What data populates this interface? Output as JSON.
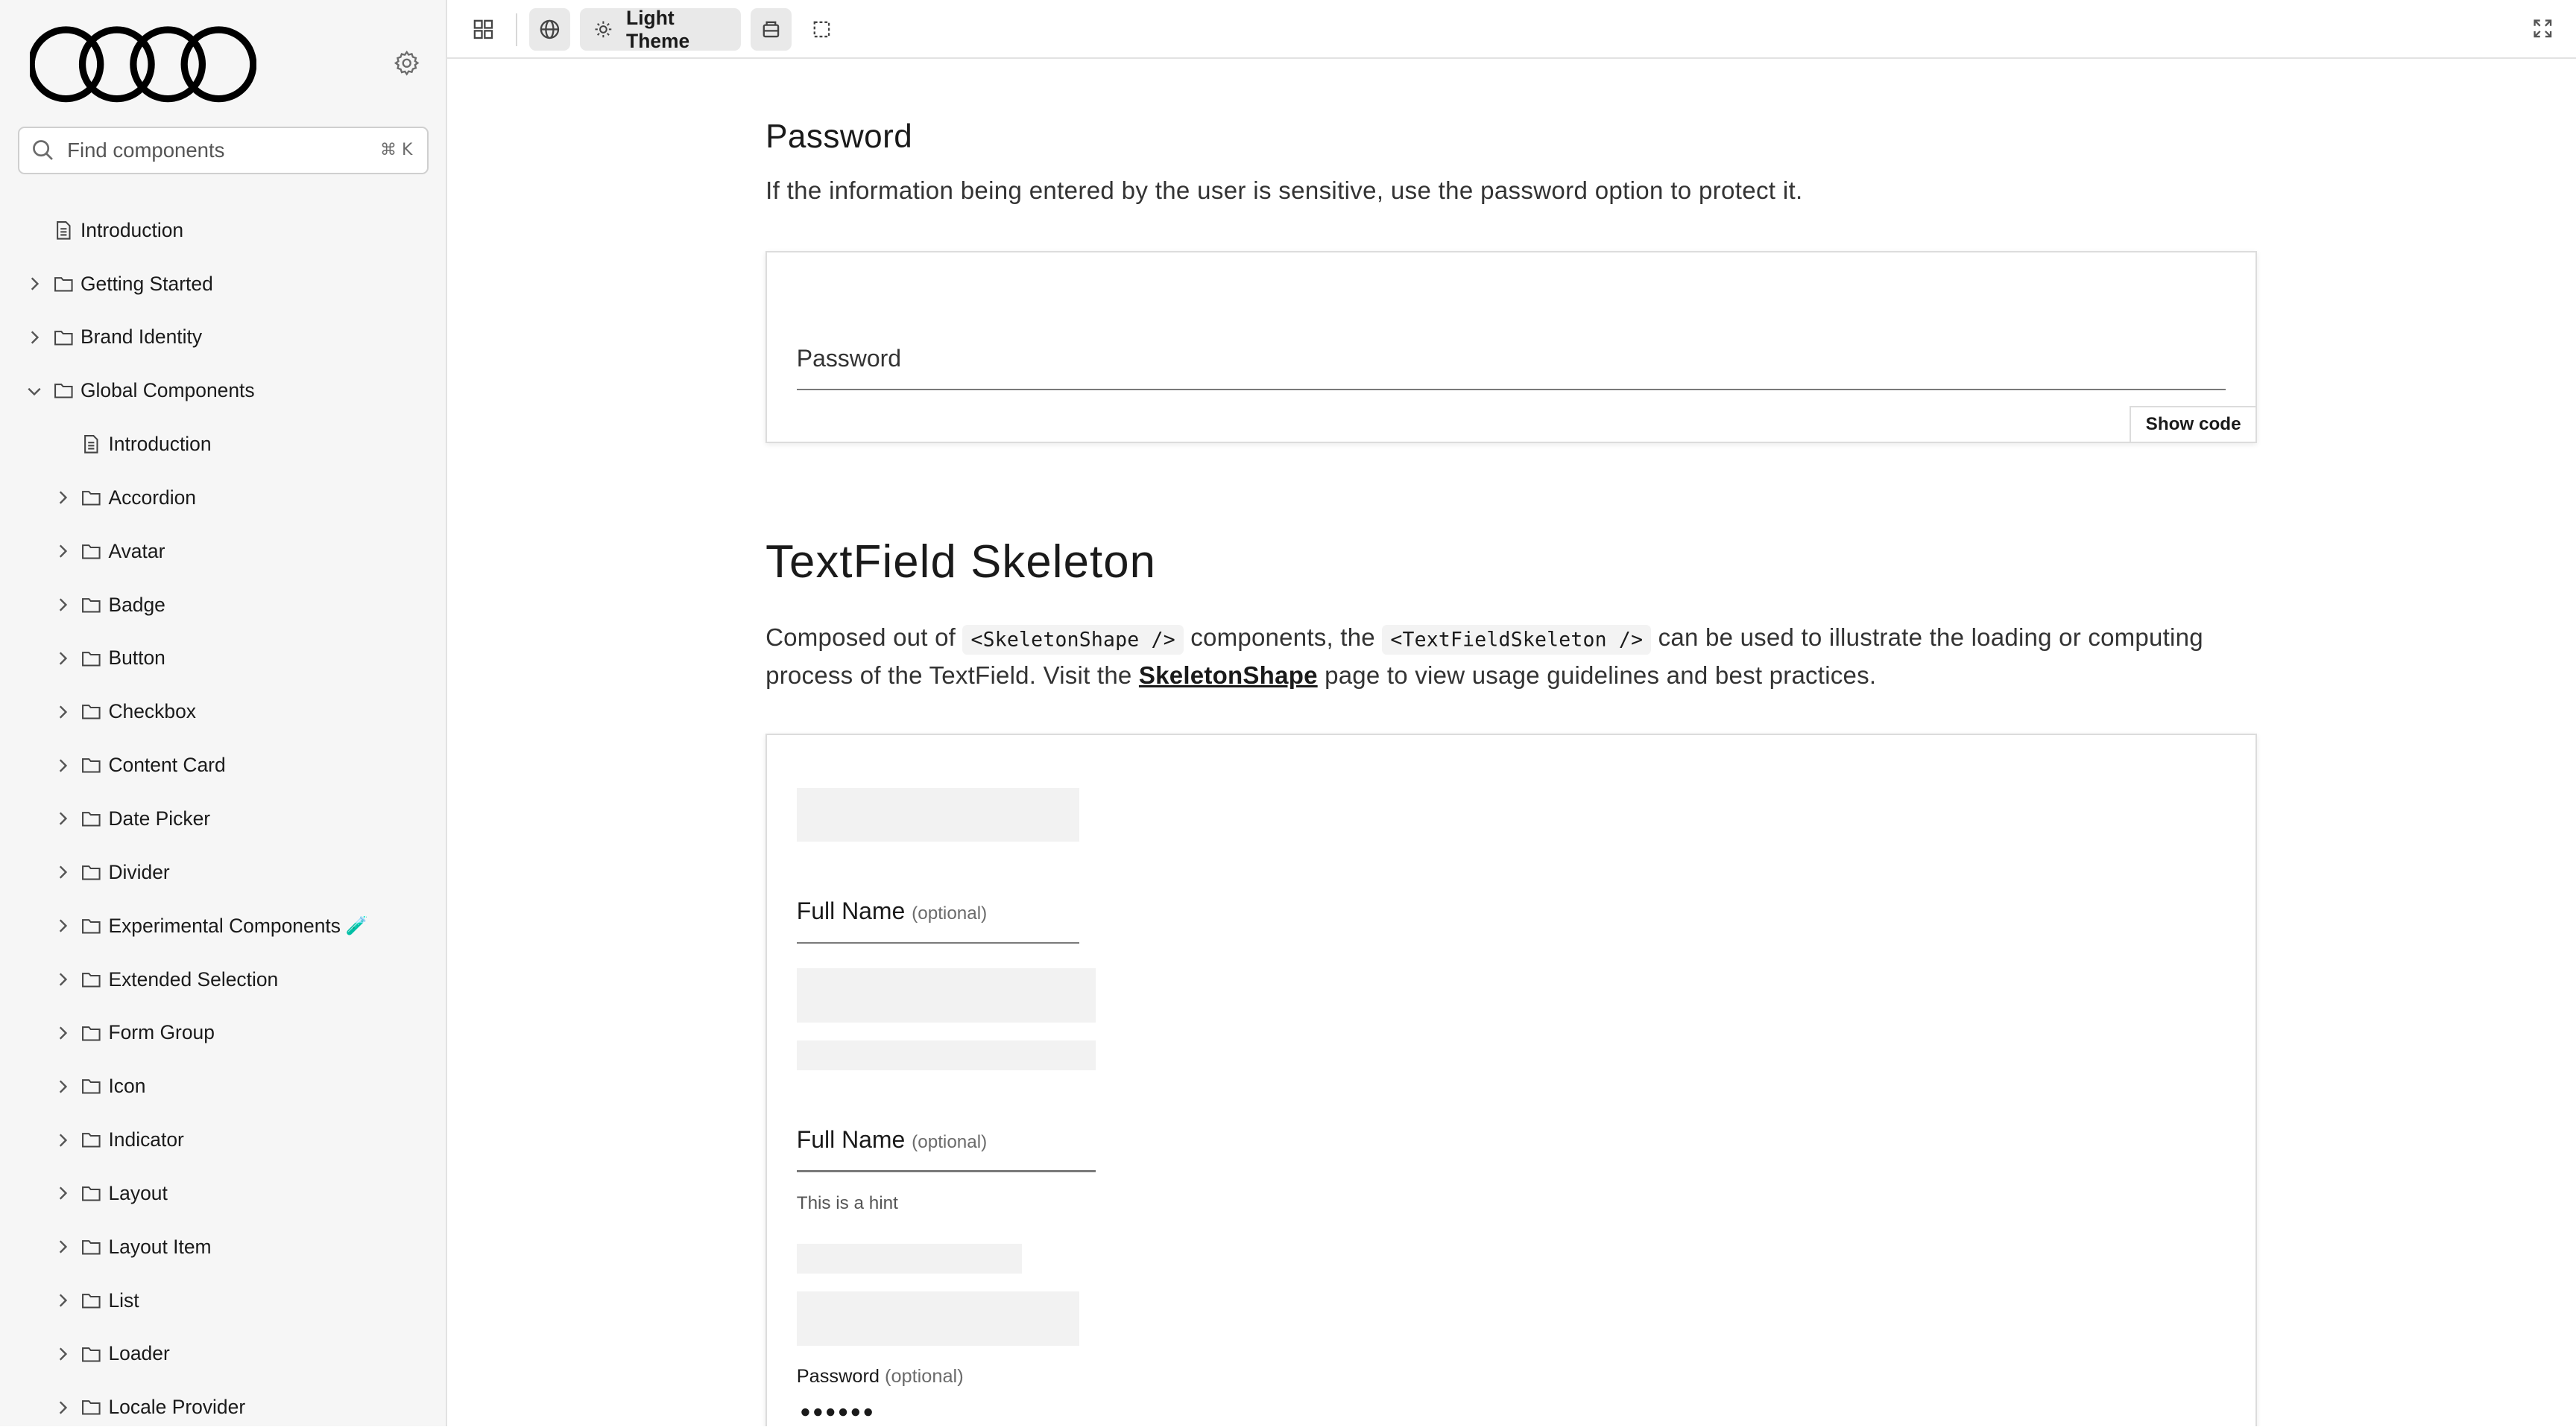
{
  "sidebar": {
    "search": {
      "placeholder": "Find components",
      "shortcut": "⌘ K"
    },
    "items": [
      {
        "label": "Introduction",
        "type": "doc",
        "level": 0
      },
      {
        "label": "Getting Started",
        "type": "folder",
        "level": 0,
        "expanded": false
      },
      {
        "label": "Brand Identity",
        "type": "folder",
        "level": 0,
        "expanded": false
      },
      {
        "label": "Global Components",
        "type": "folder",
        "level": 0,
        "expanded": true
      },
      {
        "label": "Introduction",
        "type": "doc",
        "level": 1
      },
      {
        "label": "Accordion",
        "type": "folder",
        "level": 1
      },
      {
        "label": "Avatar",
        "type": "folder",
        "level": 1
      },
      {
        "label": "Badge",
        "type": "folder",
        "level": 1
      },
      {
        "label": "Button",
        "type": "folder",
        "level": 1
      },
      {
        "label": "Checkbox",
        "type": "folder",
        "level": 1
      },
      {
        "label": "Content Card",
        "type": "folder",
        "level": 1
      },
      {
        "label": "Date Picker",
        "type": "folder",
        "level": 1
      },
      {
        "label": "Divider",
        "type": "folder",
        "level": 1
      },
      {
        "label": "Experimental Components",
        "type": "folder",
        "level": 1,
        "badge": "🧪"
      },
      {
        "label": "Extended Selection",
        "type": "folder",
        "level": 1
      },
      {
        "label": "Form Group",
        "type": "folder",
        "level": 1
      },
      {
        "label": "Icon",
        "type": "folder",
        "level": 1
      },
      {
        "label": "Indicator",
        "type": "folder",
        "level": 1
      },
      {
        "label": "Layout",
        "type": "folder",
        "level": 1
      },
      {
        "label": "Layout Item",
        "type": "folder",
        "level": 1
      },
      {
        "label": "List",
        "type": "folder",
        "level": 1
      },
      {
        "label": "Loader",
        "type": "folder",
        "level": 1
      },
      {
        "label": "Locale Provider",
        "type": "folder",
        "level": 1
      }
    ]
  },
  "toolbar": {
    "theme_label": "Light Theme"
  },
  "password_section": {
    "title": "Password",
    "description": "If the information being entered by the user is sensitive, use the password option to protect it.",
    "field_label": "Password",
    "show_code": "Show code"
  },
  "skeleton_section": {
    "title": "TextField Skeleton",
    "desc_part1": "Composed out of ",
    "code1": "<SkeletonShape />",
    "desc_part2": " components, the ",
    "code2": "<TextFieldSkeleton />",
    "desc_part3": " can be used to illustrate the loading or computing process of the TextField. Visit the ",
    "link": "SkeletonShape",
    "desc_part4": " page to view usage guidelines and best practices.",
    "field1_label": "Full Name",
    "field1_optional": "(optional)",
    "field2_label": "Full Name",
    "field2_optional": "(optional)",
    "hint": "This is a hint",
    "field3_label": "Password",
    "field3_optional": "(optional)",
    "field3_value": "●●●●●●"
  }
}
